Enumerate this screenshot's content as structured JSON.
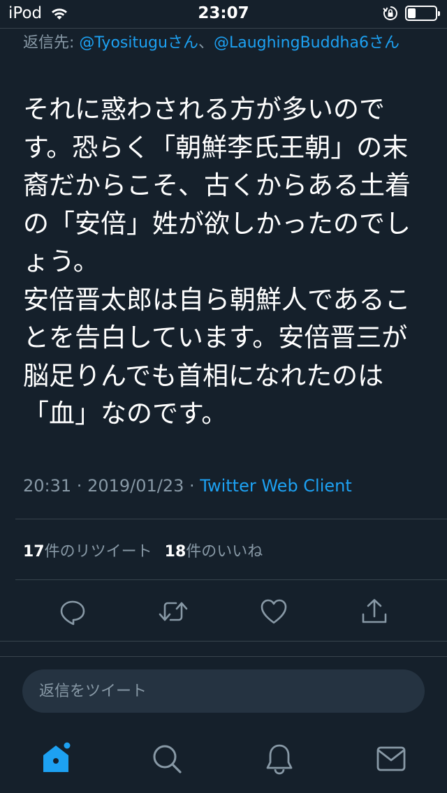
{
  "status_bar": {
    "carrier": "iPod",
    "time": "23:07",
    "battery_level": 0.3
  },
  "reply_to": {
    "label": "返信先: ",
    "mention1": "@Tyosituguさん",
    "separator": "、",
    "mention2": "@LaughingBuddha6さん"
  },
  "tweet": {
    "text": "それに惑わされる方が多いのです。恐らく「朝鮮李氏王朝」の末裔だからこそ、古くからある土着の「安倍」姓が欲しかったのでしょう。\n安倍晋太郎は自ら朝鮮人であることを告白しています。安倍晋三が脳足りんでも首相になれたのは「血」なのです。",
    "time": "20:31",
    "date": "2019/01/23",
    "dot": " · ",
    "client": "Twitter Web Client"
  },
  "stats": {
    "retweets_count": "17",
    "retweets_label": "件のリツイート",
    "likes_count": "18",
    "likes_label": "件のいいね"
  },
  "reply_box": {
    "placeholder": "返信をツイート"
  },
  "colors": {
    "background": "#15202b",
    "accent": "#1da1f2",
    "secondary_text": "#8899a6",
    "divider": "#38444d"
  },
  "icons": {
    "actions": [
      "reply-icon",
      "retweet-icon",
      "like-icon",
      "share-icon"
    ],
    "tabs": [
      "home-icon",
      "search-icon",
      "notifications-icon",
      "messages-icon"
    ]
  }
}
